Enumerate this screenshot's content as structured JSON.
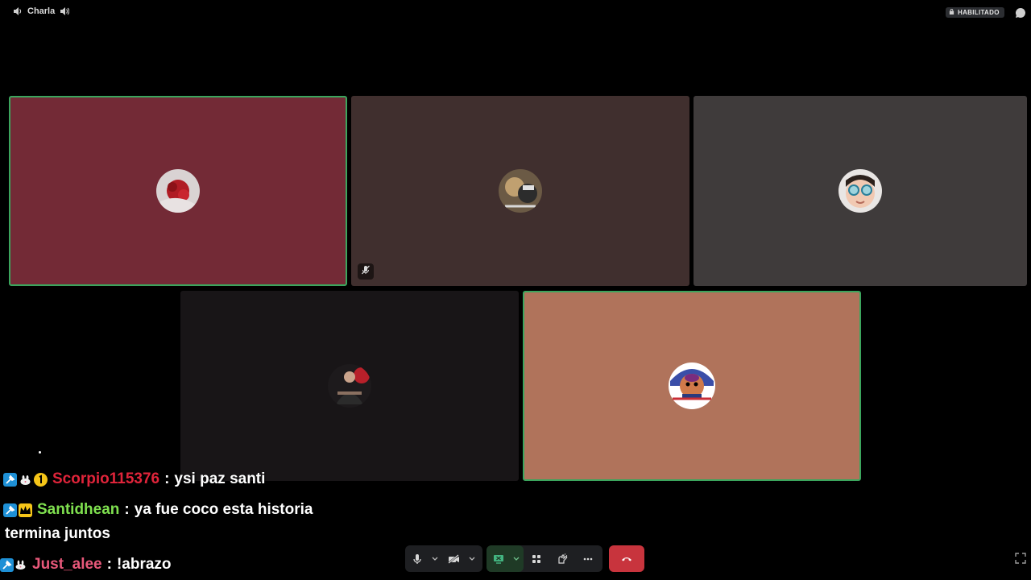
{
  "topbar": {
    "channel_name": "Charla",
    "enabled_badge": "HABILITADO"
  },
  "tiles": [
    {
      "id": "tile-1",
      "bg": "#732a36",
      "speaking": true,
      "muted": false
    },
    {
      "id": "tile-2",
      "bg": "#402f2e",
      "speaking": false,
      "muted": true
    },
    {
      "id": "tile-3",
      "bg": "#3f3b3b",
      "speaking": false,
      "muted": false
    },
    {
      "id": "tile-4",
      "bg": "#181517",
      "speaking": false,
      "muted": false
    },
    {
      "id": "tile-5",
      "bg": "#b0735b",
      "speaking": true,
      "muted": false
    }
  ],
  "chat": [
    {
      "user": "Scorpio115376",
      "color": "#e0243a",
      "message": "ysi paz santi",
      "badges": [
        "mod-icon",
        "bunny-icon",
        "sub-1-icon"
      ]
    },
    {
      "user": "Santidhean",
      "color": "#7fe04f",
      "message": "ya fue coco esta historia",
      "continuation": "termina juntos",
      "badges": [
        "mod-icon",
        "crown-icon"
      ]
    },
    {
      "user": "Just_alee",
      "color": "#e8587a",
      "message": "!abrazo",
      "badges": [
        "mod-icon",
        "bunny-icon"
      ]
    }
  ],
  "controls": {
    "items": [
      "microphone-icon",
      "camera-off-icon",
      "screen-share-icon",
      "activities-icon",
      "soundboard-icon",
      "more-icon",
      "hangup-icon",
      "fullscreen-icon"
    ]
  },
  "colors": {
    "speaking_border": "#3ba55d",
    "hangup": "#c8343d",
    "control_bg": "#1e1f22"
  }
}
